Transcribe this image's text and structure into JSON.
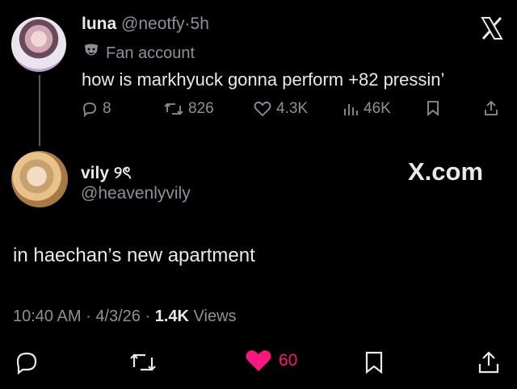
{
  "quoted_tweet": {
    "display_name": "luna",
    "handle": "@neotfy",
    "separator": "·",
    "time": "5h",
    "badge_label": "Fan account",
    "text": "how is markhyuck gonna perform +82 pressin’",
    "replies": "8",
    "reposts": "826",
    "likes": "4.3K",
    "views": "46K"
  },
  "tweet": {
    "display_name": "vily ୨ৎ",
    "handle": "@heavenlyvily",
    "watermark": "X.com",
    "text": "in haechan’s new apartment",
    "time": "10:40 AM",
    "date": "4/3/26",
    "sep1": "·",
    "sep2": "·",
    "views_count": "1.4K",
    "views_label": "Views",
    "likes": "60"
  },
  "icons": {
    "x_logo": "x-logo-icon",
    "reply": "reply-icon",
    "repost": "repost-icon",
    "like": "heart-icon",
    "views": "bar-chart-icon",
    "bookmark": "bookmark-icon",
    "share": "share-icon",
    "badge": "theater-mask-icon"
  },
  "colors": {
    "background": "#000000",
    "text": "#e7e9ea",
    "muted": "#8b9297",
    "like": "#f91880"
  }
}
